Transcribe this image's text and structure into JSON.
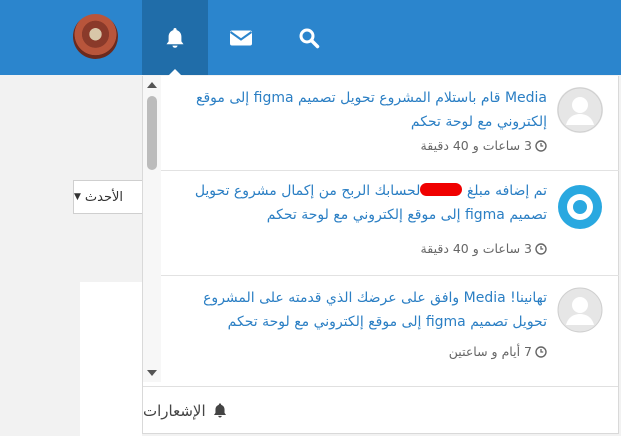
{
  "topbar": {
    "accent": "#2b85cd",
    "active_bg": "#206da9",
    "buttons": [
      {
        "name": "notifications",
        "icon": "bell-icon"
      },
      {
        "name": "messages",
        "icon": "envelope-icon"
      },
      {
        "name": "search",
        "icon": "search-icon"
      }
    ]
  },
  "sort": {
    "label": "الأحدث"
  },
  "notifications": {
    "items": [
      {
        "actor": "Media",
        "message": " قام باستلام المشروع تحويل تصميم ",
        "keyword": "figma",
        "message2": " إلى موقع إلكتروني مع لوحة تحكم",
        "time": "3 ساعات و 40 دقيقة",
        "avatar": "user-avatar-placeholder"
      },
      {
        "prefix": "تم إضافه مبلغ ",
        "message": "لحسابك الربح من إكمال مشروع تحويل تصميم ",
        "keyword": "figma",
        "message2": " إلى موقع إلكتروني مع لوحة تحكم",
        "time": "3 ساعات و 40 دقيقة",
        "avatar": "site-logo-ring"
      },
      {
        "prefix": "تهانينا! ",
        "actor": "Media",
        "message": " وافق على عرضك الذي قدمته على المشروع تحويل تصميم ",
        "keyword": "figma",
        "message2": " إلى موقع إلكتروني مع لوحة تحكم",
        "time": "7 أيام و ساعتين",
        "avatar": "user-avatar-placeholder"
      }
    ],
    "footer_label": "الإشعارات",
    "link_color": "#2b7fc4",
    "logo_color": "#29a8e0"
  }
}
